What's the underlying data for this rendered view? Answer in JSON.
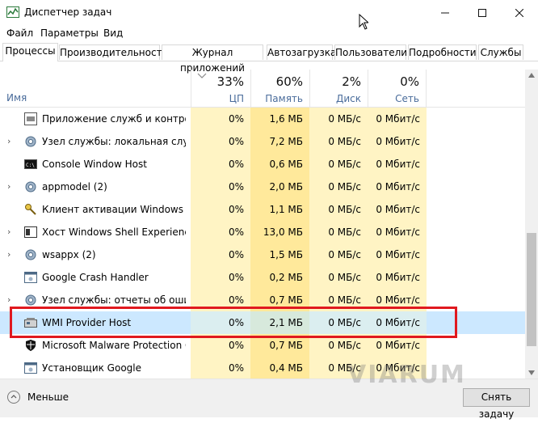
{
  "window": {
    "title": "Диспетчер задач"
  },
  "menu": [
    "Файл",
    "Параметры",
    "Вид"
  ],
  "tabs": [
    "Процессы",
    "Производительность",
    "Журнал приложений",
    "Автозагрузка",
    "Пользователи",
    "Подробности",
    "Службы"
  ],
  "columns": {
    "name": "Имя",
    "cpu": {
      "pct": "33%",
      "label": "ЦП"
    },
    "memory": {
      "pct": "60%",
      "label": "Память"
    },
    "disk": {
      "pct": "2%",
      "label": "Диск"
    },
    "network": {
      "pct": "0%",
      "label": "Сеть"
    }
  },
  "rows": [
    {
      "name": "Приложение служб и контро...",
      "cpu": "0%",
      "memory": "1,6 МБ",
      "disk": "0 МБ/с",
      "network": "0 Мбит/с",
      "expandable": false,
      "icon": "app-services-icon"
    },
    {
      "name": "Узел службы: локальная служ...",
      "cpu": "0%",
      "memory": "7,2 МБ",
      "disk": "0 МБ/с",
      "network": "0 Мбит/с",
      "expandable": true,
      "icon": "gear-icon"
    },
    {
      "name": "Console Window Host",
      "cpu": "0%",
      "memory": "0,6 МБ",
      "disk": "0 МБ/с",
      "network": "0 Мбит/с",
      "expandable": false,
      "icon": "console-icon"
    },
    {
      "name": "appmodel (2)",
      "cpu": "0%",
      "memory": "2,0 МБ",
      "disk": "0 МБ/с",
      "network": "0 Мбит/с",
      "expandable": true,
      "icon": "gear-icon"
    },
    {
      "name": "Клиент активации Windows",
      "cpu": "0%",
      "memory": "1,1 МБ",
      "disk": "0 МБ/с",
      "network": "0 Мбит/с",
      "expandable": false,
      "icon": "key-icon"
    },
    {
      "name": "Хост Windows Shell Experience ...",
      "cpu": "0%",
      "memory": "13,0 МБ",
      "disk": "0 МБ/с",
      "network": "0 Мбит/с",
      "expandable": true,
      "icon": "shell-icon"
    },
    {
      "name": "wsappx (2)",
      "cpu": "0%",
      "memory": "1,5 МБ",
      "disk": "0 МБ/с",
      "network": "0 Мбит/с",
      "expandable": true,
      "icon": "gear-icon"
    },
    {
      "name": "Google Crash Handler",
      "cpu": "0%",
      "memory": "0,2 МБ",
      "disk": "0 МБ/с",
      "network": "0 Мбит/с",
      "expandable": false,
      "icon": "app-generic-icon"
    },
    {
      "name": "Узел службы: отчеты об оши...",
      "cpu": "0%",
      "memory": "0,7 МБ",
      "disk": "0 МБ/с",
      "network": "0 Мбит/с",
      "expandable": true,
      "icon": "gear-icon"
    },
    {
      "name": "WMI Provider Host",
      "cpu": "0%",
      "memory": "2,1 МБ",
      "disk": "0 МБ/с",
      "network": "0 Мбит/с",
      "expandable": false,
      "icon": "wmi-icon",
      "selected": true
    },
    {
      "name": "Microsoft Malware Protection C...",
      "cpu": "0%",
      "memory": "0,7 МБ",
      "disk": "0 МБ/с",
      "network": "0 Мбит/с",
      "expandable": false,
      "icon": "shield-icon"
    },
    {
      "name": "Установщик Google",
      "cpu": "0%",
      "memory": "0,4 МБ",
      "disk": "0 МБ/с",
      "network": "0 Мбит/с",
      "expandable": false,
      "icon": "app-generic-icon"
    }
  ],
  "footer": {
    "fewer_label": "Меньше",
    "end_task_label": "Снять задачу"
  },
  "watermark": "VIARUM",
  "colors": {
    "highlight": "#e0191f",
    "selected_row": "#cce8ff",
    "cpu_heat": "#fff4c4",
    "memory_heat": "#ffe99b"
  }
}
